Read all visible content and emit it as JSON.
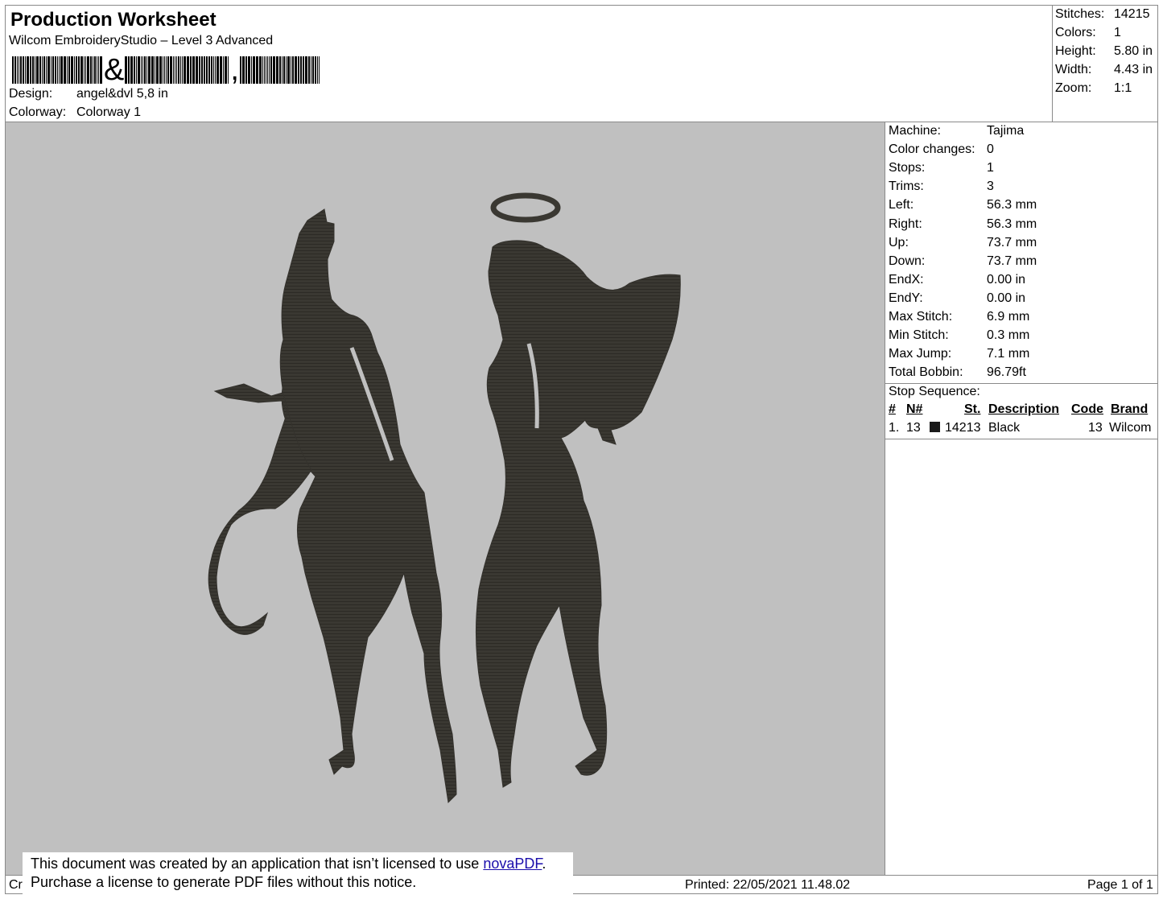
{
  "header": {
    "title": "Production Worksheet",
    "software": "Wilcom EmbroideryStudio – Level 3 Advanced",
    "barcode_mid": "&",
    "barcode_end": ",",
    "design_label": "Design:",
    "design_value": "angel&dvl 5,8 in",
    "colorway_label": "Colorway:",
    "colorway_value": "Colorway 1"
  },
  "summary": [
    {
      "label": "Stitches:",
      "value": "14215"
    },
    {
      "label": "Colors:",
      "value": "1"
    },
    {
      "label": "Height:",
      "value": "5.80 in"
    },
    {
      "label": "Width:",
      "value": "4.43 in"
    },
    {
      "label": "Zoom:",
      "value": "1:1"
    }
  ],
  "details": [
    {
      "label": "Machine:",
      "value": "Tajima"
    },
    {
      "label": "Color changes:",
      "value": "0"
    },
    {
      "label": "Stops:",
      "value": "1"
    },
    {
      "label": "Trims:",
      "value": "3"
    },
    {
      "label": "Left:",
      "value": "56.3 mm"
    },
    {
      "label": "Right:",
      "value": "56.3 mm"
    },
    {
      "label": "Up:",
      "value": "73.7 mm"
    },
    {
      "label": "Down:",
      "value": "73.7 mm"
    },
    {
      "label": "EndX:",
      "value": "0.00 in"
    },
    {
      "label": "EndY:",
      "value": "0.00 in"
    },
    {
      "label": "Max Stitch:",
      "value": "6.9 mm"
    },
    {
      "label": "Min Stitch:",
      "value": "0.3 mm"
    },
    {
      "label": "Max Jump:",
      "value": "7.1 mm"
    },
    {
      "label": "Total Bobbin:",
      "value": "96.79ft"
    }
  ],
  "stop_sequence": {
    "title": "Stop Sequence:",
    "headers": {
      "num": "#",
      "needle": "N#",
      "stitches": "St.",
      "description": "Description",
      "code": "Code",
      "brand": "Brand"
    },
    "rows": [
      {
        "num": "1.",
        "needle": "13",
        "color": "#1a1a1a",
        "stitches": "14213",
        "description": "Black",
        "code": "13",
        "brand": "Wilcom"
      }
    ]
  },
  "preview": {
    "thread_color": "#3a3832",
    "background": "#c0c0c0"
  },
  "footer": {
    "left": "Cr",
    "printed": "Printed: 22/05/2021 11.48.02",
    "page": "Page 1 of 1"
  },
  "notice": {
    "line1_pre": "This document was created by an application that isn’t licensed to use ",
    "link": "novaPDF",
    "line1_post": ".",
    "line2": "Purchase a license to generate PDF files without this notice."
  }
}
